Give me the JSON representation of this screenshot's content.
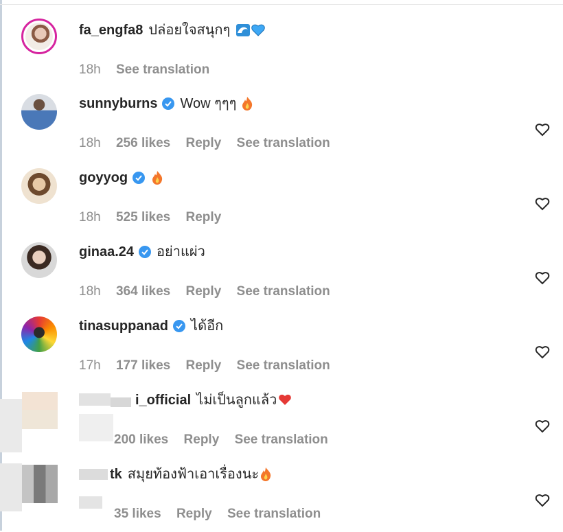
{
  "comments": [
    {
      "username": "fa_engfa8",
      "verified": false,
      "text": "ปล่อยใจสนุกๆ",
      "emoji": [
        "wave-icon",
        "blue-heart-icon"
      ],
      "time": "18h",
      "likes": "",
      "reply": "",
      "translation": "See translation"
    },
    {
      "username": "sunnyburns",
      "verified": true,
      "text": "Wow ๆๆๆ",
      "emoji": [
        "fire-icon"
      ],
      "time": "18h",
      "likes": "256 likes",
      "reply": "Reply",
      "translation": "See translation"
    },
    {
      "username": "goyyog",
      "verified": true,
      "text": "",
      "emoji": [
        "fire-icon"
      ],
      "time": "18h",
      "likes": "525 likes",
      "reply": "Reply",
      "translation": ""
    },
    {
      "username": "ginaa.24",
      "verified": true,
      "text": "อย่าแผ่ว",
      "emoji": [],
      "time": "18h",
      "likes": "364 likes",
      "reply": "Reply",
      "translation": "See translation"
    },
    {
      "username": "tinasuppanad",
      "verified": true,
      "text": "ได้อีก",
      "emoji": [],
      "time": "17h",
      "likes": "177 likes",
      "reply": "Reply",
      "translation": "See translation"
    },
    {
      "username": "i_official",
      "verified": false,
      "text": "ไม่เป็นลูกแล้ว",
      "emoji": [
        "heart-broken-icon"
      ],
      "time": "",
      "likes": "200 likes",
      "reply": "Reply",
      "translation": "See translation"
    },
    {
      "username": "tk",
      "verified": false,
      "text": "สมุยท้องฟ้าเอาเรื่องนะ",
      "emoji": [
        "fire-icon"
      ],
      "time": "",
      "likes": "35 likes",
      "reply": "Reply",
      "translation": "See translation"
    }
  ],
  "colors": {
    "verified": "#3897f0",
    "meta": "#8e8e8e",
    "text": "#262626",
    "fire": "#f4772b",
    "blue_heart": "#3ea8f5"
  }
}
